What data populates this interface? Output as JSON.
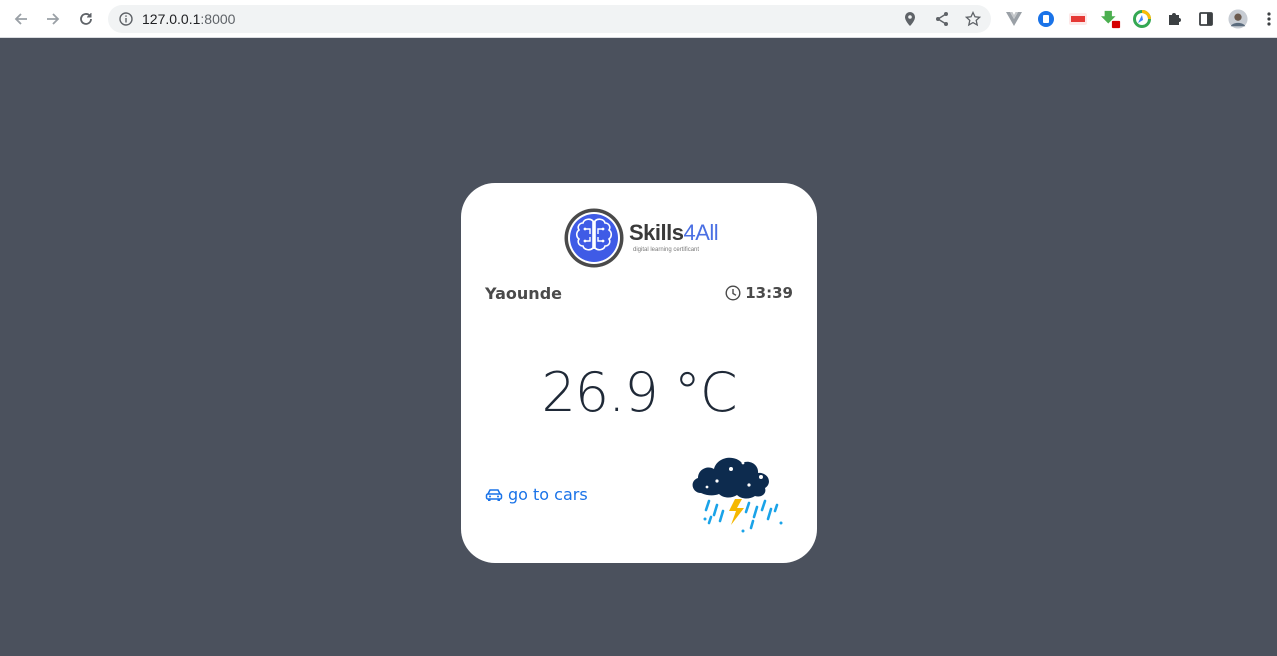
{
  "browser": {
    "url_host": "127.0.0.1",
    "url_port": ":8000",
    "back_icon": "arrow-left-icon",
    "forward_icon": "arrow-right-icon",
    "reload_icon": "reload-icon",
    "site_info_icon": "info-icon",
    "location_icon": "location-pin-icon",
    "share_icon": "share-icon",
    "bookmark_icon": "star-icon",
    "extensions": [
      "vue-devtools-icon",
      "blue-extension-icon",
      "red-extension-icon",
      "green-extension-icon",
      "google-extension-icon",
      "puzzle-icon",
      "side-panel-icon",
      "profile-avatar",
      "more-menu-icon"
    ]
  },
  "card": {
    "logo": {
      "name_main": "Skills",
      "name_accent": "4All",
      "tagline": "digital learning certificant"
    },
    "city": "Yaounde",
    "time": "13:39",
    "temperature": "26.9 °C",
    "link_label": "go to cars",
    "weather_icon": "thunderstorm-cloud-icon",
    "colors": {
      "link": "#1a73e8",
      "background": "#4b515d",
      "logo_accent": "#4a6fe3",
      "cloud": "#0d2b4e",
      "rain": "#1aa3e8",
      "lightning": "#f5b800"
    }
  }
}
